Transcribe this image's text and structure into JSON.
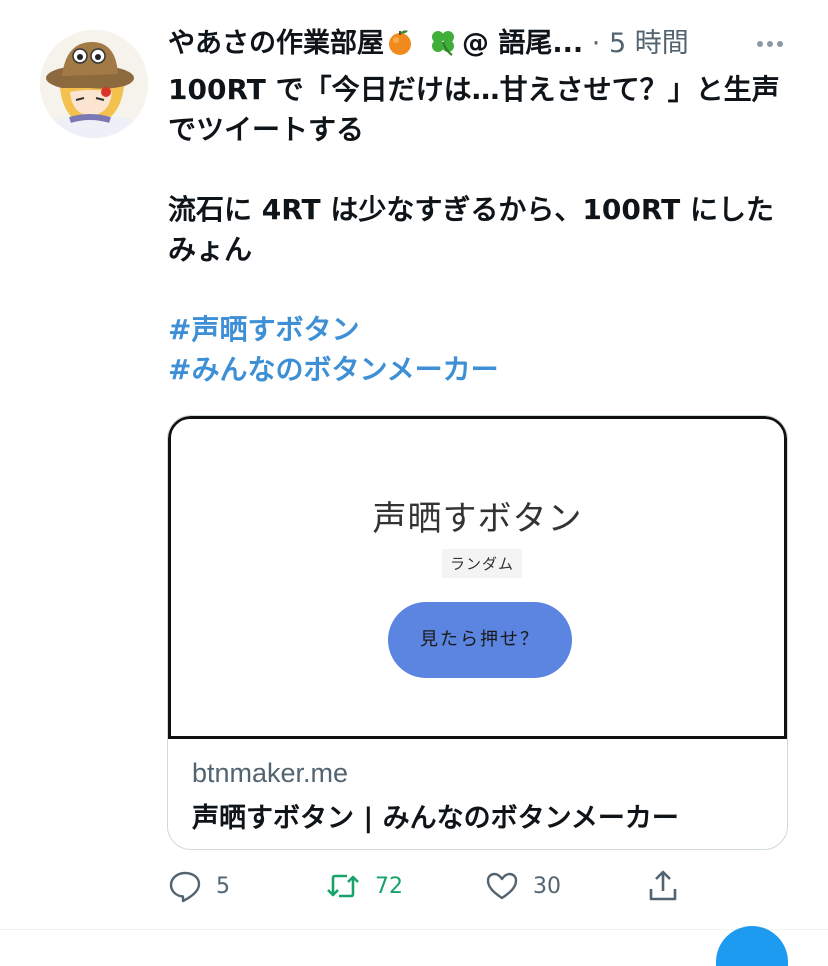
{
  "tweet": {
    "display_name": "やあさの作業部屋",
    "handle_truncated": "@ 語尾...",
    "separator": "·",
    "time": "5 時間",
    "text_line_1": "100RT で「今日だけは…甘えさせて？」と生声でツイートする",
    "text_line_2": "流石に 4RT は少なすぎるから、100RT にしたみょん",
    "hashtags": [
      "#声晒すボタン",
      "#みんなのボタンメーカー"
    ]
  },
  "card": {
    "media_title": "声晒すボタン",
    "media_tag": "ランダム",
    "media_button": "見たら押せ？",
    "domain": "btnmaker.me",
    "title": "声晒すボタン | みんなのボタンメーカー"
  },
  "actions": {
    "replies": "5",
    "retweets": "72",
    "likes": "30"
  },
  "colors": {
    "hashtag": "#3d8fd6",
    "retweet_active": "#17a36a",
    "secondary_text": "#536471",
    "card_button": "#5b85e0"
  },
  "icons": [
    "avatar",
    "orange-emoji",
    "clover-emoji",
    "more-icon",
    "reply-icon",
    "retweet-icon",
    "like-icon",
    "share-icon"
  ]
}
